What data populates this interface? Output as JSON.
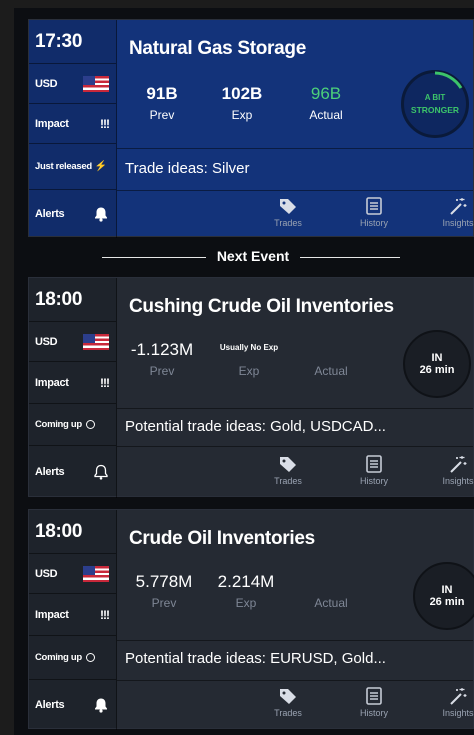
{
  "next_event_label": "Next Event",
  "colors": {
    "released_bg": "#13337a",
    "released_left": "#112c6a",
    "upcoming_bg": "#252a33",
    "upcoming_left": "#1e232b",
    "actual_green": "#4cd07a",
    "stronger_green": "#3cc46a"
  },
  "cards": [
    {
      "time": "17:30",
      "currency": "USD",
      "impact_label": "Impact",
      "impact_marks": "!!!",
      "status": "Just released",
      "status_icon": "lightning-icon",
      "alerts_label": "Alerts",
      "title": "Natural Gas Storage",
      "prev_value": "91B",
      "prev_label": "Prev",
      "exp_value": "102B",
      "exp_label": "Exp",
      "actual_value": "96B",
      "actual_label": "Actual",
      "badge_line1": "A BIT",
      "badge_line2": "STRONGER",
      "ideas": "Trade ideas: Silver",
      "nav": [
        "Trades",
        "History",
        "Insights"
      ]
    },
    {
      "time": "18:00",
      "currency": "USD",
      "impact_label": "Impact",
      "impact_marks": "!!!",
      "status": "Coming up",
      "status_icon": "circle-icon",
      "alerts_label": "Alerts",
      "title": "Cushing Crude Oil Inventories",
      "prev_value": "-1.123M",
      "prev_label": "Prev",
      "exp_value": "Usually No Exp",
      "exp_label": "Exp",
      "actual_value": "",
      "actual_label": "Actual",
      "badge_line1": "IN",
      "badge_line2": "26 min",
      "ideas": "Potential trade ideas: Gold, USDCAD...",
      "nav": [
        "Trades",
        "History",
        "Insights"
      ]
    },
    {
      "time": "18:00",
      "currency": "USD",
      "impact_label": "Impact",
      "impact_marks": "!!!",
      "status": "Coming up",
      "status_icon": "circle-icon",
      "alerts_label": "Alerts",
      "title": "Crude Oil Inventories",
      "prev_value": "5.778M",
      "prev_label": "Prev",
      "exp_value": "2.214M",
      "exp_label": "Exp",
      "actual_value": "",
      "actual_label": "Actual",
      "badge_line1": "IN",
      "badge_line2": "26 min",
      "ideas": "Potential trade ideas: EURUSD, Gold...",
      "nav": [
        "Trades",
        "History",
        "Insights"
      ]
    }
  ]
}
